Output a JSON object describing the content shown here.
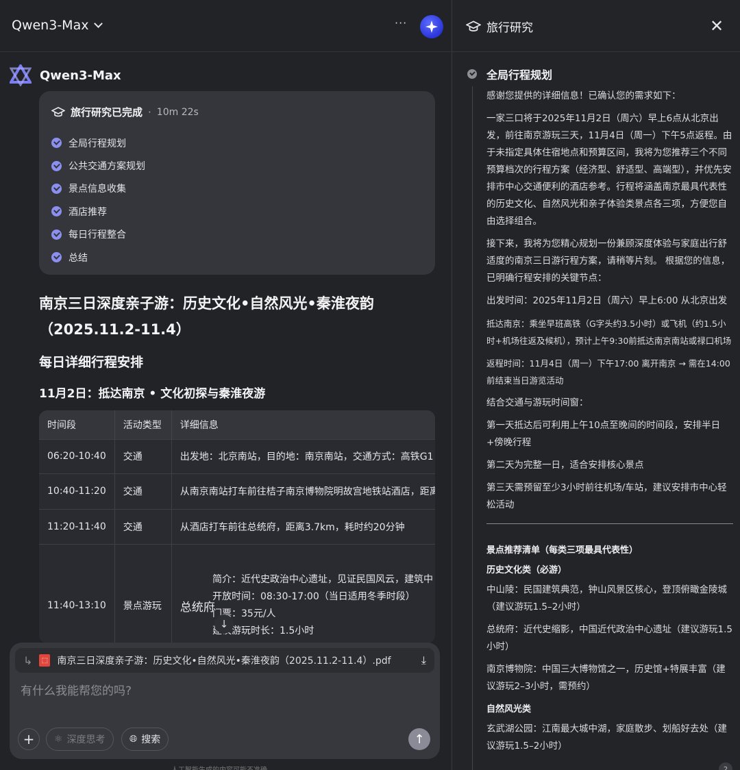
{
  "header": {
    "model_name": "Qwen3-Max",
    "more_label": "···"
  },
  "bot": {
    "name": "Qwen3-Max"
  },
  "status_card": {
    "title": "旅行研究已完成",
    "separator": "·",
    "duration": "10m 22s",
    "steps": [
      "全局行程规划",
      "公共交通方案规划",
      "景点信息收集",
      "酒店推荐",
      "每日行程整合",
      "总结"
    ]
  },
  "doc": {
    "title": "南京三日深度亲子游：历史文化•自然风光•秦淮夜韵（2025.11.2-11.4）",
    "h2": "每日详细行程安排",
    "h3": "11月2日：抵达南京 • 文化初探与秦淮夜游",
    "table": {
      "headers": [
        "时间段",
        "活动类型",
        "详细信息"
      ],
      "rows": [
        [
          "06:20-10:40",
          "交通",
          "出发地：北京南站，目的地：南京南站，交通方式：高铁G1"
        ],
        [
          "10:40-11:20",
          "交通",
          "从南京南站打车前往桔子南京博物院明故宫地铁站酒店，距离"
        ],
        [
          "11:20-11:40",
          "交通",
          "从酒店打车前往总统府，距离3.7km，耗时约20分钟"
        ],
        [
          "11:40-13:10",
          "景点游玩",
          "总统府"
        ]
      ],
      "detail_lines": [
        "简介：近代史政治中心遗址，见证民国风云，建筑中",
        "开放时间：08:30-17:00（当日适用冬季时段）",
        "门票：35元/人",
        "建议游玩时长：1.5小时"
      ]
    }
  },
  "input": {
    "attachment_name": "南京三日深度亲子游：历史文化•自然风光•秦淮夜韵（2025.11.2-11.4）.pdf",
    "placeholder": "有什么我能帮您的吗?",
    "think_label": "深度思考",
    "search_label": "搜索",
    "disclaimer": "人工智能生成的内容可能不准确"
  },
  "panel": {
    "title": "旅行研究",
    "section_title": "全局行程规划",
    "paragraphs": [
      "感谢您提供的详细信息！已确认您的需求如下：",
      "一家三口将于2025年11月2日（周六）早上6点从北京出发，前往南京游玩三天，11月4日（周一）下午5点返程。由于未指定具体住宿地点和预算区间，我将为您推荐三个不同预算档次的行程方案（经济型、舒适型、高端型），并优先安排市中心交通便利的酒店参考。行程将涵盖南京最具代表性的历史文化、自然风光和亲子体验类景点各三项，方便您自由选择组合。",
      "接下来，我将为您精心规划一份兼顾深度体验与家庭出行舒适度的南京三日游行程方案，请稍等片刻。 根据您的信息，已明确行程安排的关键节点：",
      "出发时间：2025年11月2日（周六）早上6:00 从北京出发"
    ],
    "arrival": "抵达南京：乘坐早班高铁（G字头约3.5小时）或飞机（约1.5小时+机场往返及候机），预计上午9:30前抵达南京南站或禄口机场",
    "return": "返程时间：11月4日（周一）下午17:00 离开南京 → 需在14:00前结束当日游览活动",
    "window_title": "结合交通与游玩时间窗：",
    "windows": [
      "第一天抵达后可利用上午10点至晚间的时间段，安排半日+傍晚行程",
      "第二天为完整一日，适合安排核心景点",
      "第三天需预留至少3小时前往机场/车站，建议安排市中心轻松活动"
    ],
    "rec_title": "景点推荐清单（每类三项最具代表性）",
    "cat1": "历史文化类（必游）",
    "cat1_items": [
      "中山陵：民国建筑典范，钟山风景区核心，登顶俯瞰金陵城（建议游玩1.5–2小时）",
      "总统府：近代史缩影，中国近代政治中心遗址（建议游玩1.5小时）",
      "南京博物院：中国三大博物馆之一，历史馆+特展丰富（建议游玩2–3小时，需预约）"
    ],
    "cat2": "自然风光类",
    "cat2_items": [
      "玄武湖公园：江南最大城中湖，家庭散步、划船好去处（建议游玩1.5–2小时）"
    ],
    "badge": "2"
  }
}
